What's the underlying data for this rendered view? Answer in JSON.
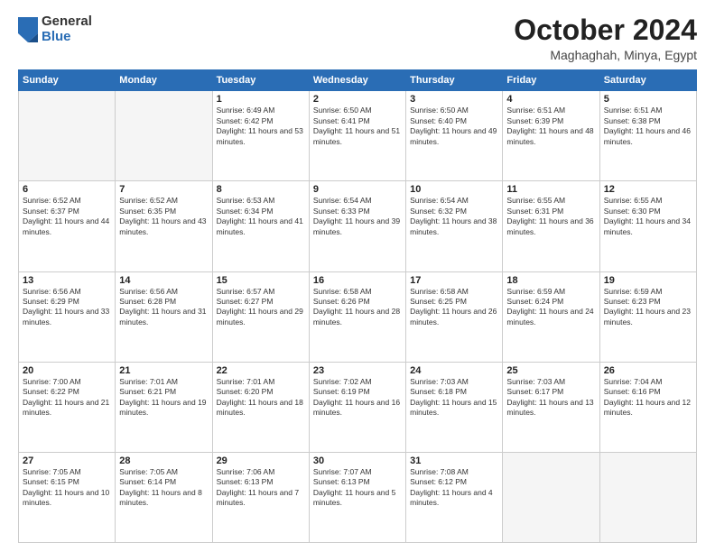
{
  "logo": {
    "general": "General",
    "blue": "Blue"
  },
  "header": {
    "month": "October 2024",
    "location": "Maghaghah, Minya, Egypt"
  },
  "weekdays": [
    "Sunday",
    "Monday",
    "Tuesday",
    "Wednesday",
    "Thursday",
    "Friday",
    "Saturday"
  ],
  "weeks": [
    [
      {
        "day": "",
        "text": ""
      },
      {
        "day": "",
        "text": ""
      },
      {
        "day": "1",
        "text": "Sunrise: 6:49 AM\nSunset: 6:42 PM\nDaylight: 11 hours and 53 minutes."
      },
      {
        "day": "2",
        "text": "Sunrise: 6:50 AM\nSunset: 6:41 PM\nDaylight: 11 hours and 51 minutes."
      },
      {
        "day": "3",
        "text": "Sunrise: 6:50 AM\nSunset: 6:40 PM\nDaylight: 11 hours and 49 minutes."
      },
      {
        "day": "4",
        "text": "Sunrise: 6:51 AM\nSunset: 6:39 PM\nDaylight: 11 hours and 48 minutes."
      },
      {
        "day": "5",
        "text": "Sunrise: 6:51 AM\nSunset: 6:38 PM\nDaylight: 11 hours and 46 minutes."
      }
    ],
    [
      {
        "day": "6",
        "text": "Sunrise: 6:52 AM\nSunset: 6:37 PM\nDaylight: 11 hours and 44 minutes."
      },
      {
        "day": "7",
        "text": "Sunrise: 6:52 AM\nSunset: 6:35 PM\nDaylight: 11 hours and 43 minutes."
      },
      {
        "day": "8",
        "text": "Sunrise: 6:53 AM\nSunset: 6:34 PM\nDaylight: 11 hours and 41 minutes."
      },
      {
        "day": "9",
        "text": "Sunrise: 6:54 AM\nSunset: 6:33 PM\nDaylight: 11 hours and 39 minutes."
      },
      {
        "day": "10",
        "text": "Sunrise: 6:54 AM\nSunset: 6:32 PM\nDaylight: 11 hours and 38 minutes."
      },
      {
        "day": "11",
        "text": "Sunrise: 6:55 AM\nSunset: 6:31 PM\nDaylight: 11 hours and 36 minutes."
      },
      {
        "day": "12",
        "text": "Sunrise: 6:55 AM\nSunset: 6:30 PM\nDaylight: 11 hours and 34 minutes."
      }
    ],
    [
      {
        "day": "13",
        "text": "Sunrise: 6:56 AM\nSunset: 6:29 PM\nDaylight: 11 hours and 33 minutes."
      },
      {
        "day": "14",
        "text": "Sunrise: 6:56 AM\nSunset: 6:28 PM\nDaylight: 11 hours and 31 minutes."
      },
      {
        "day": "15",
        "text": "Sunrise: 6:57 AM\nSunset: 6:27 PM\nDaylight: 11 hours and 29 minutes."
      },
      {
        "day": "16",
        "text": "Sunrise: 6:58 AM\nSunset: 6:26 PM\nDaylight: 11 hours and 28 minutes."
      },
      {
        "day": "17",
        "text": "Sunrise: 6:58 AM\nSunset: 6:25 PM\nDaylight: 11 hours and 26 minutes."
      },
      {
        "day": "18",
        "text": "Sunrise: 6:59 AM\nSunset: 6:24 PM\nDaylight: 11 hours and 24 minutes."
      },
      {
        "day": "19",
        "text": "Sunrise: 6:59 AM\nSunset: 6:23 PM\nDaylight: 11 hours and 23 minutes."
      }
    ],
    [
      {
        "day": "20",
        "text": "Sunrise: 7:00 AM\nSunset: 6:22 PM\nDaylight: 11 hours and 21 minutes."
      },
      {
        "day": "21",
        "text": "Sunrise: 7:01 AM\nSunset: 6:21 PM\nDaylight: 11 hours and 19 minutes."
      },
      {
        "day": "22",
        "text": "Sunrise: 7:01 AM\nSunset: 6:20 PM\nDaylight: 11 hours and 18 minutes."
      },
      {
        "day": "23",
        "text": "Sunrise: 7:02 AM\nSunset: 6:19 PM\nDaylight: 11 hours and 16 minutes."
      },
      {
        "day": "24",
        "text": "Sunrise: 7:03 AM\nSunset: 6:18 PM\nDaylight: 11 hours and 15 minutes."
      },
      {
        "day": "25",
        "text": "Sunrise: 7:03 AM\nSunset: 6:17 PM\nDaylight: 11 hours and 13 minutes."
      },
      {
        "day": "26",
        "text": "Sunrise: 7:04 AM\nSunset: 6:16 PM\nDaylight: 11 hours and 12 minutes."
      }
    ],
    [
      {
        "day": "27",
        "text": "Sunrise: 7:05 AM\nSunset: 6:15 PM\nDaylight: 11 hours and 10 minutes."
      },
      {
        "day": "28",
        "text": "Sunrise: 7:05 AM\nSunset: 6:14 PM\nDaylight: 11 hours and 8 minutes."
      },
      {
        "day": "29",
        "text": "Sunrise: 7:06 AM\nSunset: 6:13 PM\nDaylight: 11 hours and 7 minutes."
      },
      {
        "day": "30",
        "text": "Sunrise: 7:07 AM\nSunset: 6:13 PM\nDaylight: 11 hours and 5 minutes."
      },
      {
        "day": "31",
        "text": "Sunrise: 7:08 AM\nSunset: 6:12 PM\nDaylight: 11 hours and 4 minutes."
      },
      {
        "day": "",
        "text": ""
      },
      {
        "day": "",
        "text": ""
      }
    ]
  ]
}
